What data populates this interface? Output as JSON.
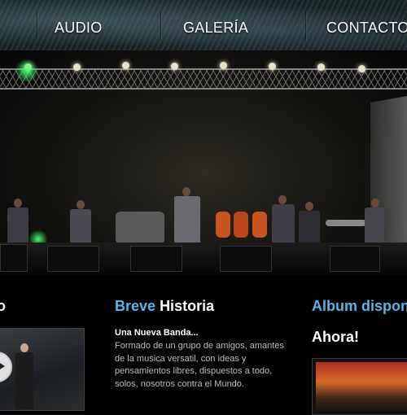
{
  "nav": {
    "items": [
      {
        "label": "AUDIO"
      },
      {
        "label": "GALERÍA"
      },
      {
        "label": "CONTACTO"
      }
    ]
  },
  "sections": {
    "left": {
      "title_white": "o"
    },
    "historia": {
      "title_blue": "Breve",
      "title_white": "Historia",
      "subtitle": "Una Nueva Banda...",
      "text": "Formado de un grupo de amigos, amantes de la musica versatil, con ideas y pensamientos libres, dispuestos a todo, solos, nosotros contra el Mundo."
    },
    "album": {
      "title_blue": "Album dispon",
      "headline": "Ahora!"
    }
  },
  "icons": {
    "play": "play-icon"
  },
  "colors": {
    "accent": "#5bb4e6",
    "background": "#000000"
  }
}
